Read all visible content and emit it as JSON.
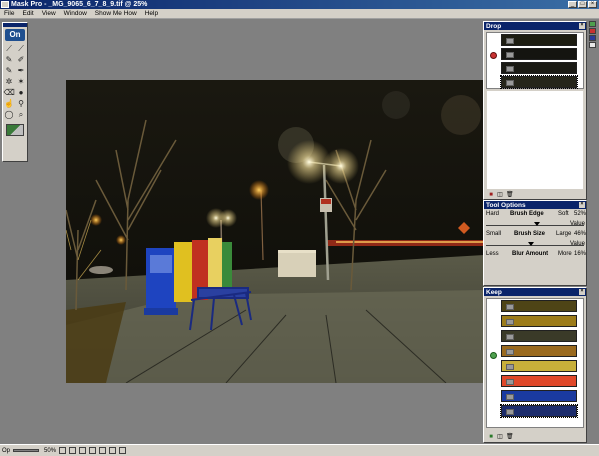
{
  "window": {
    "title": "Mask Pro - _MG_9065_6_7_8_9.tif @ 25%"
  },
  "menu": [
    "File",
    "Edit",
    "View",
    "Window",
    "Show Me How",
    "Help"
  ],
  "toolbox": {
    "logo": "On",
    "tools": [
      "dropper-keep",
      "dropper-drop",
      "pen",
      "brush",
      "magic-brush",
      "magic-pen",
      "magic-wand",
      "fill",
      "eraser",
      "blur",
      "smudge",
      "burn",
      "lasso",
      "zoom-lasso",
      "hand",
      "zoom"
    ]
  },
  "status": {
    "label": "Op",
    "zoom": "50%"
  },
  "drop_panel": {
    "title": "Drop",
    "colors": [
      "#1d1d12",
      "#141410",
      "#1a1a14",
      "#25251a"
    ]
  },
  "tool_options": {
    "title": "Tool Options",
    "brush_edge": {
      "left": "Hard",
      "label": "Brush Edge",
      "right": "Soft",
      "value": "52%",
      "value_label": "Value",
      "position": 0.52
    },
    "brush_size": {
      "left": "Small",
      "label": "Brush Size",
      "right": "Large",
      "value": "46%",
      "value_label": "Value",
      "position": 0.46
    },
    "blur_amount": {
      "left": "Less",
      "label": "Blur Amount",
      "right": "More",
      "value": "16%",
      "value_label": "Value",
      "position": 0.16
    }
  },
  "keep_panel": {
    "title": "Keep",
    "colors": [
      "#4e4416",
      "#9c7c1a",
      "#3a3a28",
      "#9a6a1e",
      "#c8b03a",
      "#e0482a",
      "#1a3aa0",
      "#1c2c6c"
    ]
  },
  "side_colors": [
    "#4ea04e",
    "#c83232",
    "#2a3a9a",
    "#e8e8e8"
  ]
}
